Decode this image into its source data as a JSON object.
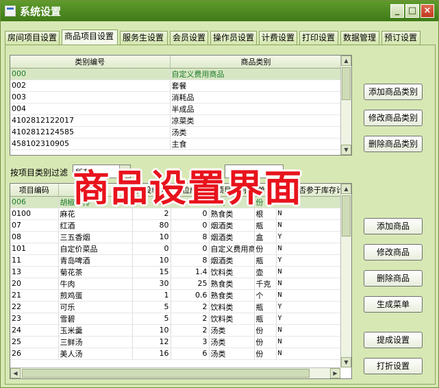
{
  "window": {
    "title": "系统设置",
    "minimize": "_",
    "maximize": "□",
    "close": "×"
  },
  "tabs": [
    {
      "label": "房间项目设置"
    },
    {
      "label": "商品项目设置"
    },
    {
      "label": "服务生设置"
    },
    {
      "label": "会员设置"
    },
    {
      "label": "操作员设置"
    },
    {
      "label": "计费设置"
    },
    {
      "label": "打印设置"
    },
    {
      "label": "数据管理"
    },
    {
      "label": "预订设置"
    }
  ],
  "category_grid": {
    "headers": [
      "类别编号",
      "商品类别"
    ],
    "rows": [
      [
        "000",
        "自定义费用商品"
      ],
      [
        "002",
        "套餐"
      ],
      [
        "003",
        "消耗品"
      ],
      [
        "004",
        "半成品"
      ],
      [
        "4102812122017",
        "凉菜类"
      ],
      [
        "4102812124585",
        "汤类"
      ],
      [
        "458102310905",
        "主食"
      ]
    ]
  },
  "category_buttons": {
    "add": "添加商品类别",
    "edit": "修改商品类别",
    "delete": "删除商品类别"
  },
  "filter": {
    "label": "按项目类别过滤",
    "selected": "所有",
    "label2": "类"
  },
  "item_grid": {
    "headers": [
      "项目编码",
      "名称",
      "预设单价",
      "单位成本",
      "项目类别",
      "单位",
      "是否参于库存计算"
    ],
    "rows": [
      [
        "006",
        "胡椒牛排",
        "50",
        "20.6",
        "套餐",
        "份",
        "N"
      ],
      [
        "0100",
        "麻花",
        "2",
        "0",
        "熟食类",
        "根",
        "N"
      ],
      [
        "07",
        "红酒",
        "80",
        "0",
        "烟酒类",
        "瓶",
        "N"
      ],
      [
        "08",
        "三五香烟",
        "10",
        "8",
        "烟酒类",
        "盒",
        "Y"
      ],
      [
        "101",
        "自定价菜品",
        "0",
        "0",
        "自定义费用商",
        "份",
        "N"
      ],
      [
        "11",
        "青岛啤酒",
        "10",
        "8",
        "烟酒类",
        "瓶",
        "Y"
      ],
      [
        "13",
        "菊花茶",
        "15",
        "1.4",
        "饮料类",
        "壶",
        "N"
      ],
      [
        "20",
        "牛肉",
        "30",
        "25",
        "熟食类",
        "千克",
        "N"
      ],
      [
        "21",
        "煎鸡蛋",
        "1",
        "0.6",
        "熟食类",
        "个",
        "N"
      ],
      [
        "22",
        "可乐",
        "5",
        "2",
        "饮料类",
        "瓶",
        "Y"
      ],
      [
        "23",
        "雪碧",
        "5",
        "2",
        "饮料类",
        "瓶",
        "Y"
      ],
      [
        "24",
        "玉米羹",
        "10",
        "2",
        "汤类",
        "份",
        "N"
      ],
      [
        "25",
        "三鲜汤",
        "12",
        "3",
        "汤类",
        "份",
        "N"
      ],
      [
        "26",
        "美人汤",
        "16",
        "6",
        "汤类",
        "份",
        "N"
      ]
    ]
  },
  "item_buttons": {
    "add": "添加商品",
    "edit": "修改商品",
    "delete": "删除商品",
    "menu": "生成菜单",
    "commission": "提成设置",
    "discount": "打折设置"
  },
  "overlay": {
    "text": "商品设置界面"
  }
}
